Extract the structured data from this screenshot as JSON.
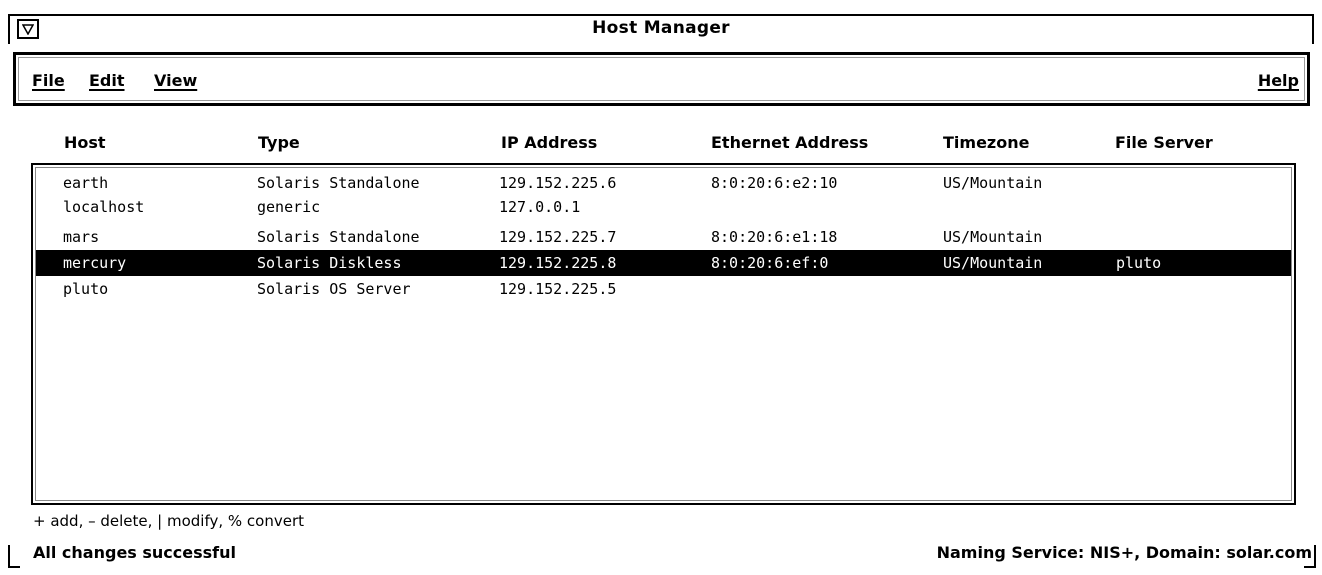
{
  "window": {
    "title": "Host Manager",
    "menu_icon": "triangle-down-icon"
  },
  "menubar": {
    "file": "File",
    "edit": "Edit",
    "view": "View",
    "help": "Help"
  },
  "columns": [
    "Host",
    "Type",
    "IP Address",
    "Ethernet Address",
    "Timezone",
    "File Server"
  ],
  "rows": [
    {
      "host": "earth",
      "type": "Solaris Standalone",
      "ip": "129.152.225.6",
      "ether": "8:0:20:6:e2:10",
      "tz": "US/Mountain",
      "server": "",
      "selected": false
    },
    {
      "host": "localhost",
      "type": "generic",
      "ip": "127.0.0.1",
      "ether": "",
      "tz": "",
      "server": "",
      "selected": false
    },
    {
      "host": "mars",
      "type": "Solaris Standalone",
      "ip": "129.152.225.7",
      "ether": "8:0:20:6:e1:18",
      "tz": "US/Mountain",
      "server": "",
      "selected": false
    },
    {
      "host": "mercury",
      "type": "Solaris Diskless",
      "ip": "129.152.225.8",
      "ether": "8:0:20:6:ef:0",
      "tz": "US/Mountain",
      "server": "pluto",
      "selected": true
    },
    {
      "host": "pluto",
      "type": "Solaris OS Server",
      "ip": "129.152.225.5",
      "ether": "",
      "tz": "",
      "server": "",
      "selected": false
    }
  ],
  "footer": {
    "hint": "+ add, – delete, | modify, % convert",
    "status": "All changes successful",
    "naming": "Naming Service: NIS+, Domain: solar.com"
  }
}
